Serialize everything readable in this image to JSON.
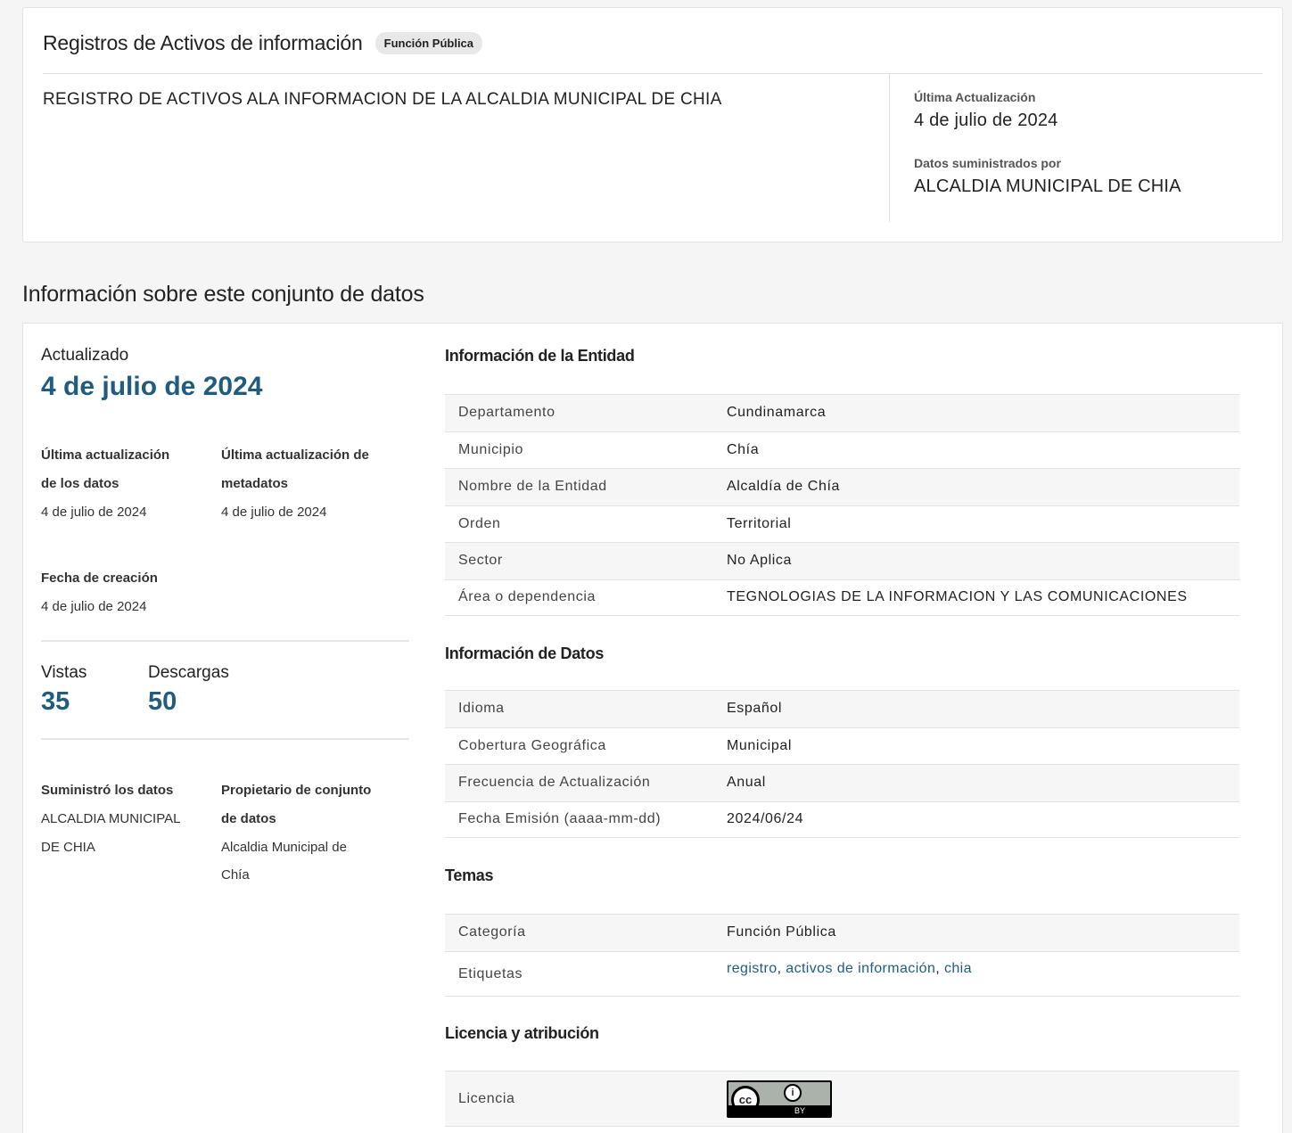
{
  "header": {
    "title": "Registros de Activos de información",
    "badge": "Función Pública",
    "description": "REGISTRO DE ACTIVOS ALA INFORMACION DE LA ALCALDIA MUNICIPAL DE CHIA",
    "last_update_label": "Última Actualización",
    "last_update_value": "4 de julio de 2024",
    "provided_by_label": "Datos suministrados por",
    "provided_by_value": "ALCALDIA MUNICIPAL DE CHIA"
  },
  "section_heading": "Información sobre este conjunto de datos",
  "summary": {
    "updated_label": "Actualizado",
    "updated_value": "4 de julio de 2024",
    "data_update_label_1": "Última actualización",
    "data_update_label_2": "de los datos",
    "data_update_value": "4 de julio de 2024",
    "meta_update_label_1": "Última actualización de",
    "meta_update_label_2": "metadatos",
    "meta_update_value": "4 de julio de 2024",
    "created_label": "Fecha de creación",
    "created_value": "4 de julio de 2024",
    "views_label": "Vistas",
    "views_value": "35",
    "downloads_label": "Descargas",
    "downloads_value": "50",
    "supplier_label": "Suministró los datos",
    "supplier_value_1": "ALCALDIA MUNICIPAL",
    "supplier_value_2": "DE CHIA",
    "owner_label_1": "Propietario de conjunto",
    "owner_label_2": "de datos",
    "owner_value_1": "Alcaldia Municipal de",
    "owner_value_2": "Chía"
  },
  "entity": {
    "title": "Información de la Entidad",
    "rows": [
      {
        "key": "Departamento",
        "value": "Cundinamarca"
      },
      {
        "key": "Municipio",
        "value": "Chía"
      },
      {
        "key": "Nombre de la Entidad",
        "value": "Alcaldía de Chía"
      },
      {
        "key": "Orden",
        "value": "Territorial"
      },
      {
        "key": "Sector",
        "value": "No Aplica"
      },
      {
        "key": "Área o dependencia",
        "value": "TEGNOLOGIAS DE LA INFORMACION Y LAS COMUNICACIONES"
      }
    ]
  },
  "data_info": {
    "title": "Información de Datos",
    "rows": [
      {
        "key": "Idioma",
        "value": "Español"
      },
      {
        "key": "Cobertura Geográfica",
        "value": "Municipal"
      },
      {
        "key": "Frecuencia de Actualización",
        "value": "Anual"
      },
      {
        "key": "Fecha Emisión (aaaa-mm-dd)",
        "value": "2024/06/24"
      }
    ]
  },
  "topics": {
    "title": "Temas",
    "category_key": "Categoría",
    "category_value": "Función Pública",
    "tags_key": "Etiquetas",
    "tags": [
      "registro",
      "activos de información",
      "chia"
    ]
  },
  "license": {
    "title": "Licencia y atribución",
    "license_key": "Licencia",
    "badge_text": "BY",
    "cc_text": "cc"
  }
}
